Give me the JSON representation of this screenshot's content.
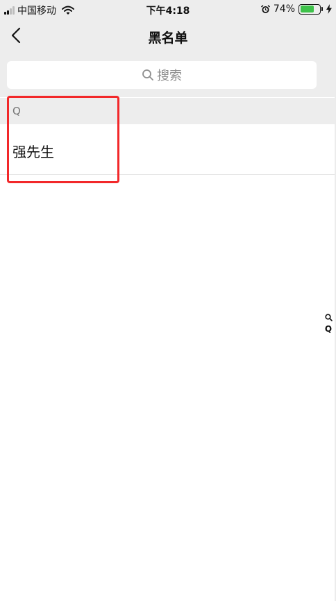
{
  "status_bar": {
    "carrier": "中国移动",
    "time": "下午4:18",
    "battery_percent": "74%",
    "battery_level": 0.74
  },
  "nav": {
    "title": "黑名单"
  },
  "search": {
    "placeholder": "搜索"
  },
  "sections": [
    {
      "letter": "Q",
      "contacts": [
        {
          "name": "强先生"
        }
      ]
    }
  ],
  "index_bar": {
    "letters": [
      "Q"
    ]
  },
  "colors": {
    "background_gray": "#ededed",
    "highlight_red": "#f2282a",
    "battery_green": "#3ec24a"
  }
}
